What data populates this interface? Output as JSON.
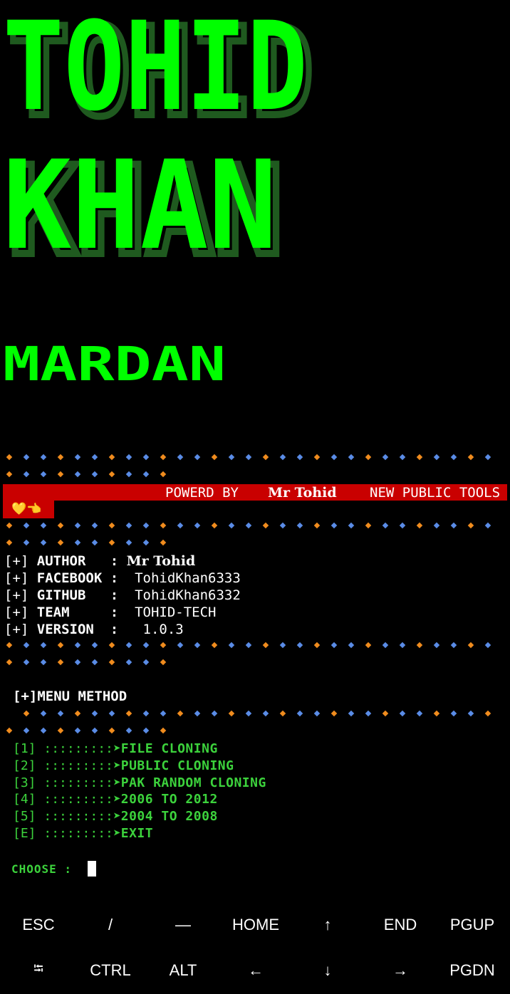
{
  "banner": {
    "line1": "TOHID",
    "line2": "KHAN",
    "line3": "MARDAN",
    "color": "#00ff00",
    "shade": "#1f5a1f"
  },
  "powered_bar": {
    "prefix": "POWERD BY",
    "name": "Mr Tohid",
    "suffix": "NEW PUBLIC TOOLS",
    "emoji": "💛👈",
    "color": "#c90000"
  },
  "info": {
    "prefix": "[+]",
    "rows": [
      {
        "label": "AUTHOR   :",
        "value": "Mr Tohid"
      },
      {
        "label": "FACEBOOK :",
        "value": "TohidKhan6333"
      },
      {
        "label": "GITHUB   :",
        "value": "TohidKhan6332"
      },
      {
        "label": "TEAM     :",
        "value": "TOHID-TECH"
      },
      {
        "label": "VERSION  :",
        "value": "1.0.3"
      }
    ]
  },
  "menu": {
    "header": "[+]MENU  METHOD",
    "options": [
      {
        "key": "[1]",
        "sep": ":::::::::➤",
        "label": "FILE CLONING"
      },
      {
        "key": "[2]",
        "sep": ":::::::::➤",
        "label": "PUBLIC CLONING"
      },
      {
        "key": "[3]",
        "sep": ":::::::::➤",
        "label": "PAK RANDOM CLONING"
      },
      {
        "key": "[4]",
        "sep": ":::::::::➤",
        "label": "2006 TO 2012"
      },
      {
        "key": "[5]",
        "sep": ":::::::::➤",
        "label": "2004 TO 2008"
      },
      {
        "key": "[E]",
        "sep": ":::::::::➤",
        "label": "EXIT"
      }
    ]
  },
  "prompt": {
    "label": "CHOOSE :"
  },
  "dot_colors": {
    "orange": "#f08c1e",
    "blue": "#5a8ce6"
  },
  "keyboard": {
    "row1": [
      "ESC",
      "/",
      "—",
      "HOME",
      "↑",
      "END",
      "PGUP"
    ],
    "row2": [
      "⭾",
      "CTRL",
      "ALT",
      "←",
      "↓",
      "→",
      "PGDN"
    ]
  }
}
